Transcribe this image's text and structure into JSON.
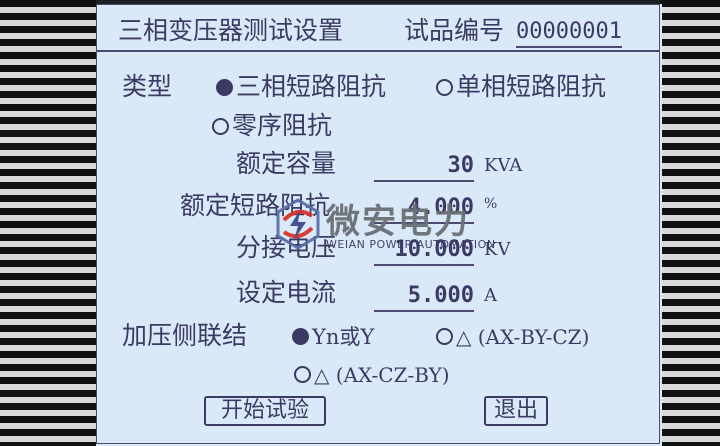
{
  "header": {
    "title": "三相变压器测试设置",
    "sample_no_label": "试品编号",
    "sample_no_value": "00000001"
  },
  "type_section": {
    "label": "类型",
    "options": [
      {
        "label": "三相短路阻抗",
        "selected": true
      },
      {
        "label": "单相短路阻抗",
        "selected": false
      },
      {
        "label": "零序阻抗",
        "selected": false
      }
    ]
  },
  "fields": [
    {
      "label": "额定容量",
      "value": "30",
      "unit": "KVA"
    },
    {
      "label": "额定短路阻抗",
      "value": "4.000",
      "unit": "%"
    },
    {
      "label": "分接电压",
      "value": "10.000",
      "unit": "KV"
    },
    {
      "label": "设定电流",
      "value": "5.000",
      "unit": "A"
    }
  ],
  "connection_section": {
    "label": "加压侧联结",
    "options": [
      {
        "label": "Yn或Y",
        "selected": true
      },
      {
        "label": "△ (AX-BY-CZ)",
        "selected": false
      },
      {
        "label": "△ (AX-CZ-BY)",
        "selected": false
      }
    ]
  },
  "buttons": {
    "start": "开始试验",
    "exit": "退出"
  },
  "watermark": {
    "title": "微安电力",
    "subtitle": "WEIAN POWER AUTOMATION"
  },
  "colors": {
    "screen_bg": "#d9e9f8",
    "ink": "#3c3a64"
  }
}
